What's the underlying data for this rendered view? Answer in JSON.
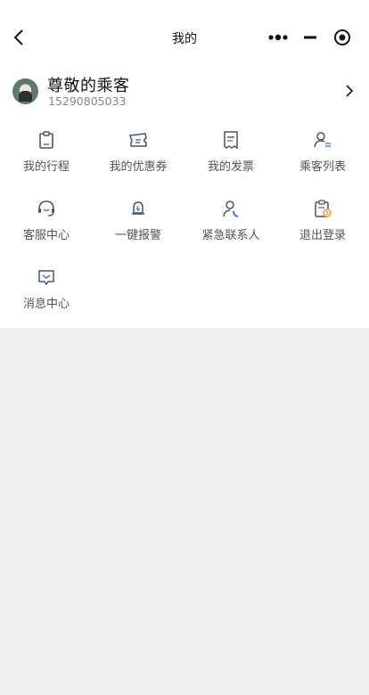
{
  "nav": {
    "title": "我的"
  },
  "profile": {
    "name": "尊敬的乘客",
    "phone": "15290805033"
  },
  "menu": [
    {
      "label": "我的行程",
      "icon": "clipboard-icon"
    },
    {
      "label": "我的优惠券",
      "icon": "ticket-icon"
    },
    {
      "label": "我的发票",
      "icon": "receipt-icon"
    },
    {
      "label": "乘客列表",
      "icon": "user-list-icon"
    },
    {
      "label": "客服中心",
      "icon": "headset-icon"
    },
    {
      "label": "一键报警",
      "icon": "alarm-bell-icon"
    },
    {
      "label": "紧急联系人",
      "icon": "contact-phone-icon"
    },
    {
      "label": "退出登录",
      "icon": "logout-icon"
    },
    {
      "label": "消息中心",
      "icon": "message-icon"
    }
  ],
  "colors": {
    "icon": "#4a5568",
    "accent_blue": "#3b7bf0",
    "accent_orange": "#f39c3c",
    "background": "#f0f0f0"
  }
}
